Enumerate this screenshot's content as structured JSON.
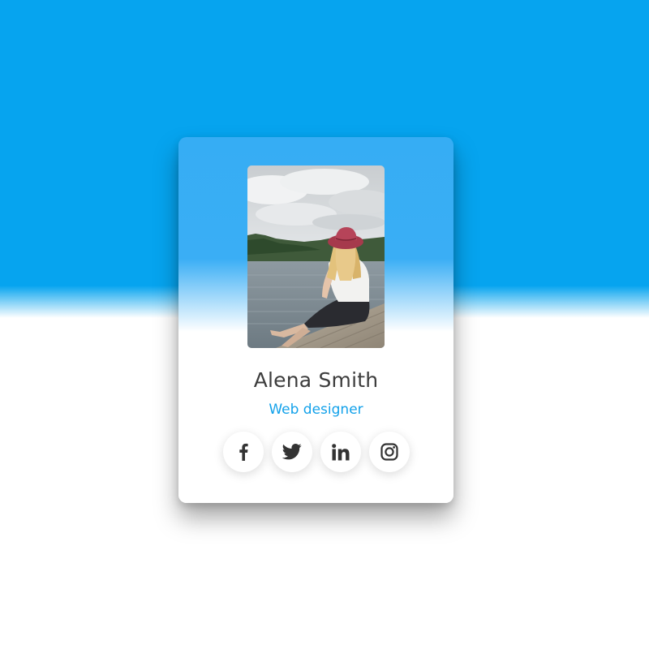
{
  "profile": {
    "name": "Alena Smith",
    "role": "Web designer"
  },
  "photo": {
    "icon": "profile-photo-woman-on-dock"
  },
  "socials": [
    {
      "id": "facebook",
      "icon": "facebook-icon"
    },
    {
      "id": "twitter",
      "icon": "twitter-icon"
    },
    {
      "id": "linkedin",
      "icon": "linkedin-icon",
      "label": "in"
    },
    {
      "id": "instagram",
      "icon": "instagram-icon"
    }
  ],
  "colors": {
    "background_top": "#06a4ef",
    "background_bottom": "#ffffff",
    "card_top": "#36adf4",
    "name": "#3c3c3c",
    "role_accent": "#12a1ea",
    "icon": "#333333"
  }
}
